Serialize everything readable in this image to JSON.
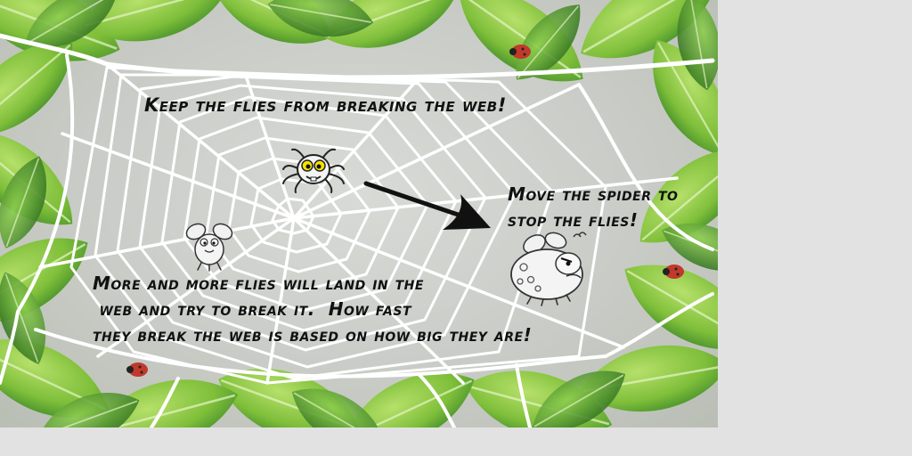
{
  "tutorial": {
    "instruction_top": "Keep the flies from breaking the web!",
    "instruction_move": "Move the spider to\nstop the flies!",
    "instruction_bottom": "More and more flies will land in the\n web and try to break it.  How fast\nthey break the web is based on how big they are!"
  },
  "sprites": {
    "spider": "spider-character",
    "small_fly": "small-fly-character",
    "big_fly": "big-fly-character",
    "arrow": "arrow-icon"
  },
  "colors": {
    "leaf_light": "#8cc63f",
    "leaf_dark": "#3f8a2a",
    "web": "#ffffff",
    "page_bg": "#e2e2e2",
    "ladybug": "#c0392b"
  }
}
